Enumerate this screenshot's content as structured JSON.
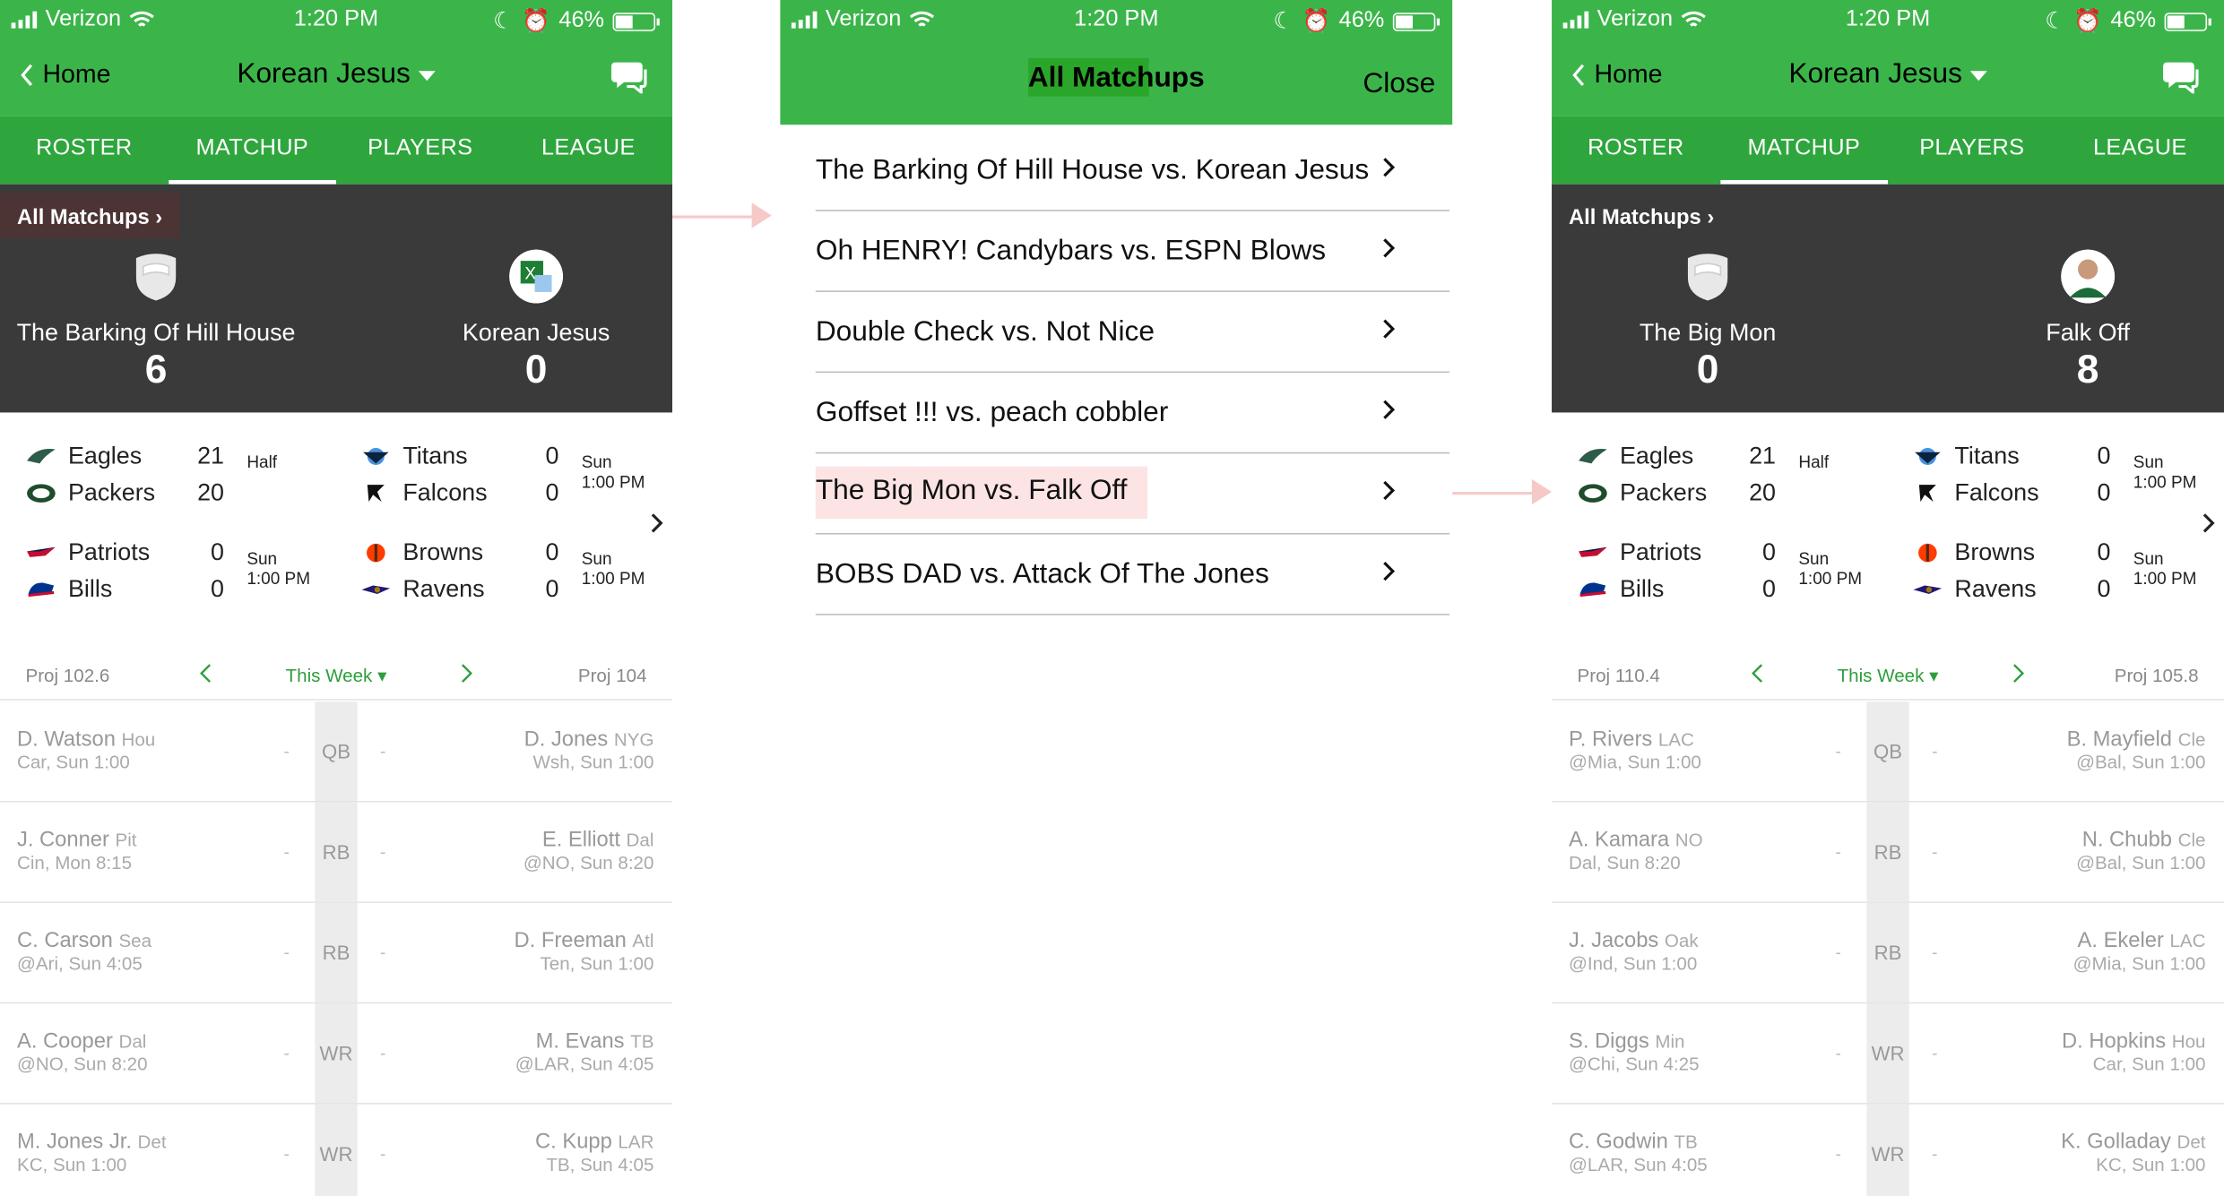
{
  "status": {
    "carrier": "Verizon",
    "time": "1:20 PM",
    "battery": "46%",
    "battery_level": 0.46
  },
  "nav": {
    "back": "Home",
    "title": "Korean Jesus"
  },
  "tabs": [
    "ROSTER",
    "MATCHUP",
    "PLAYERS",
    "LEAGUE"
  ],
  "all_matchups": "All Matchups",
  "modal": {
    "title": "All Matchups",
    "close": "Close",
    "items": [
      "The Barking Of Hill House vs. Korean Jesus",
      "Oh HENRY! Candybars vs. ESPN Blows",
      "Double Check vs. Not Nice",
      "Goffset !!! vs. peach cobbler",
      "The Big Mon vs. Falk Off",
      "BOBS DAD vs. Attack Of The Jones"
    ]
  },
  "games": [
    {
      "a": "Eagles",
      "as": "21",
      "b": "Packers",
      "bs": "20",
      "status1": "Half",
      "status2": ""
    },
    {
      "a": "Titans",
      "as": "0",
      "b": "Falcons",
      "bs": "0",
      "status1": "Sun",
      "status2": "1:00 PM"
    },
    {
      "a": "Patriots",
      "as": "0",
      "b": "Bills",
      "bs": "0",
      "status1": "Sun",
      "status2": "1:00 PM"
    },
    {
      "a": "Browns",
      "as": "0",
      "b": "Ravens",
      "bs": "0",
      "status1": "Sun",
      "status2": "1:00 PM"
    }
  ],
  "week": "This Week",
  "proj_label": "Proj",
  "dash": "-",
  "screen1": {
    "left_team": "The Barking Of Hill House",
    "left_score": "6",
    "right_team": "Korean Jesus",
    "right_score": "0",
    "proj_left": "102.6",
    "proj_right": "104",
    "slots": [
      {
        "pos": "QB",
        "l_name": "D. Watson",
        "l_team": "Hou",
        "l_game": "Car, Sun 1:00",
        "r_name": "D. Jones",
        "r_team": "NYG",
        "r_game": "Wsh, Sun 1:00"
      },
      {
        "pos": "RB",
        "l_name": "J. Conner",
        "l_team": "Pit",
        "l_game": "Cin, Mon 8:15",
        "r_name": "E. Elliott",
        "r_team": "Dal",
        "r_game": "@NO, Sun 8:20"
      },
      {
        "pos": "RB",
        "l_name": "C. Carson",
        "l_team": "Sea",
        "l_game": "@Ari, Sun 4:05",
        "r_name": "D. Freeman",
        "r_team": "Atl",
        "r_game": "Ten, Sun 1:00"
      },
      {
        "pos": "WR",
        "l_name": "A. Cooper",
        "l_team": "Dal",
        "l_game": "@NO, Sun 8:20",
        "r_name": "M. Evans",
        "r_team": "TB",
        "r_game": "@LAR, Sun 4:05"
      },
      {
        "pos": "WR",
        "l_name": "M. Jones Jr.",
        "l_team": "Det",
        "l_game": "KC, Sun 1:00",
        "r_name": "C. Kupp",
        "r_team": "LAR",
        "r_game": "TB, Sun 4:05"
      }
    ]
  },
  "screen3": {
    "left_team": "The Big Mon",
    "left_score": "0",
    "right_team": "Falk Off",
    "right_score": "8",
    "proj_left": "110.4",
    "proj_right": "105.8",
    "slots": [
      {
        "pos": "QB",
        "l_name": "P. Rivers",
        "l_team": "LAC",
        "l_game": "@Mia, Sun 1:00",
        "r_name": "B. Mayfield",
        "r_team": "Cle",
        "r_game": "@Bal, Sun 1:00"
      },
      {
        "pos": "RB",
        "l_name": "A. Kamara",
        "l_team": "NO",
        "l_game": "Dal, Sun 8:20",
        "r_name": "N. Chubb",
        "r_team": "Cle",
        "r_game": "@Bal, Sun 1:00"
      },
      {
        "pos": "RB",
        "l_name": "J. Jacobs",
        "l_team": "Oak",
        "l_game": "@Ind, Sun 1:00",
        "r_name": "A. Ekeler",
        "r_team": "LAC",
        "r_game": "@Mia, Sun 1:00"
      },
      {
        "pos": "WR",
        "l_name": "S. Diggs",
        "l_team": "Min",
        "l_game": "@Chi, Sun 4:25",
        "r_name": "D. Hopkins",
        "r_team": "Hou",
        "r_game": "Car, Sun 1:00"
      },
      {
        "pos": "WR",
        "l_name": "C. Godwin",
        "l_team": "TB",
        "l_game": "@LAR, Sun 4:05",
        "r_name": "K. Golladay",
        "r_team": "Det",
        "r_game": "KC, Sun 1:00"
      }
    ]
  },
  "colors": {
    "green": "#3bb54a",
    "tab_green": "#2ea63d",
    "dark": "#3a3a3a",
    "highlight": "#fde4e4"
  }
}
